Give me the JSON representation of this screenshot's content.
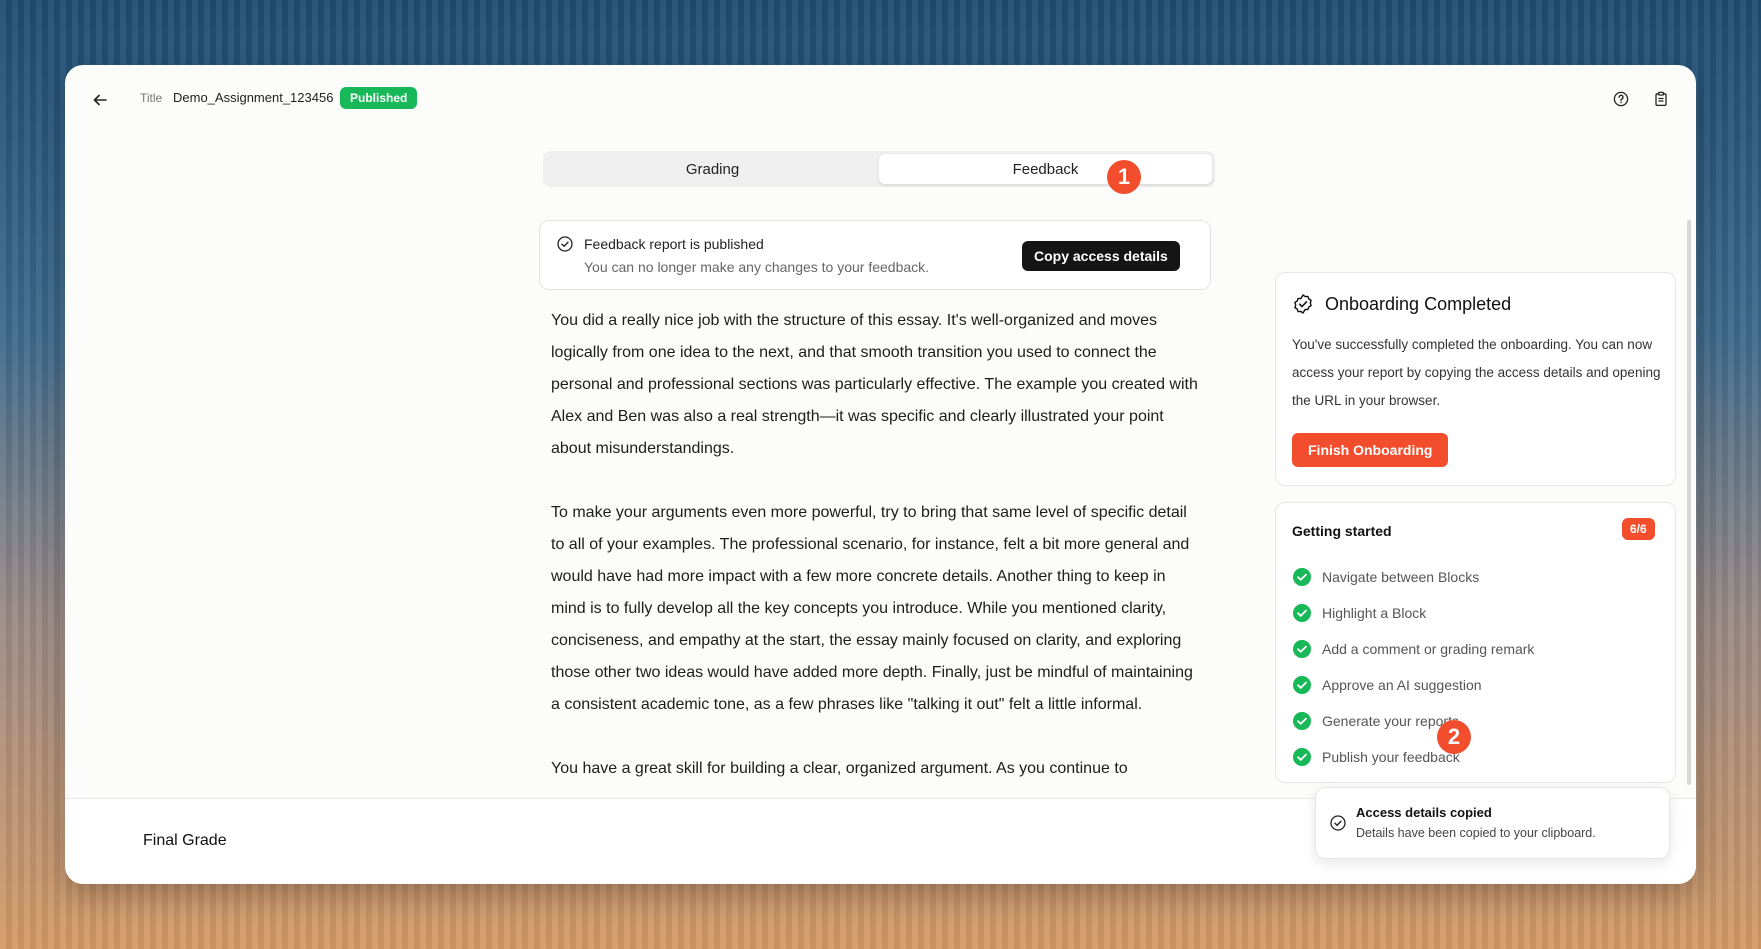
{
  "header": {
    "title_label": "Title",
    "title_value": "Demo_Assignment_123456",
    "status_badge": "Published"
  },
  "tabs": [
    {
      "label": "Grading",
      "active": false
    },
    {
      "label": "Feedback",
      "active": true
    }
  ],
  "banner": {
    "title": "Feedback report is published",
    "subtitle": "You can no longer make any changes to your feedback.",
    "copy_button": "Copy access details"
  },
  "markers": {
    "first": "1",
    "second": "2"
  },
  "feedback": {
    "paragraphs": [
      "You did a really nice job with the structure of this essay. It's well-organized and moves logically from one idea to the next, and that smooth transition you used to connect the personal and professional sections was particularly effective. The example you created with Alex and Ben was also a real strength—it was specific and clearly illustrated your point about misunderstandings.",
      "To make your arguments even more powerful, try to bring that same level of specific detail to all of your examples. The professional scenario, for instance, felt a bit more general and would have had more impact with a few more concrete details. Another thing to keep in mind is to fully develop all the key concepts you introduce. While you mentioned clarity, conciseness, and empathy at the start, the essay mainly focused on clarity, and exploring those other two ideas would have added more depth. Finally, just be mindful of maintaining a consistent academic tone, as a few phrases like \"talking it out\" felt a little informal.",
      "You have a great skill for building a clear, organized argument. As you continue to"
    ]
  },
  "onboarding": {
    "title": "Onboarding Completed",
    "text": "You've successfully completed the onboarding. You can now access your report by copying the access details and opening the URL in your browser.",
    "button": "Finish Onboarding"
  },
  "getting_started": {
    "title": "Getting started",
    "count": "6/6",
    "items": [
      "Navigate between Blocks",
      "Highlight a Block",
      "Add a comment or grading remark",
      "Approve an AI suggestion",
      "Generate your reports",
      "Publish your feedback"
    ]
  },
  "footer": {
    "final_grade_label": "Final Grade"
  },
  "toast": {
    "title": "Access details copied",
    "text": "Details have been copied to your clipboard."
  },
  "colors": {
    "accent": "#f24e2e",
    "success": "#16b857",
    "dark_button": "#151515"
  },
  "icons": {
    "back": "arrow-left-icon",
    "help": "help-circle-icon",
    "clipboard": "clipboard-icon",
    "published": "check-circle-icon",
    "onboarding": "badge-check-icon",
    "checklist": "green-check-icon",
    "toast": "check-circle-icon"
  }
}
